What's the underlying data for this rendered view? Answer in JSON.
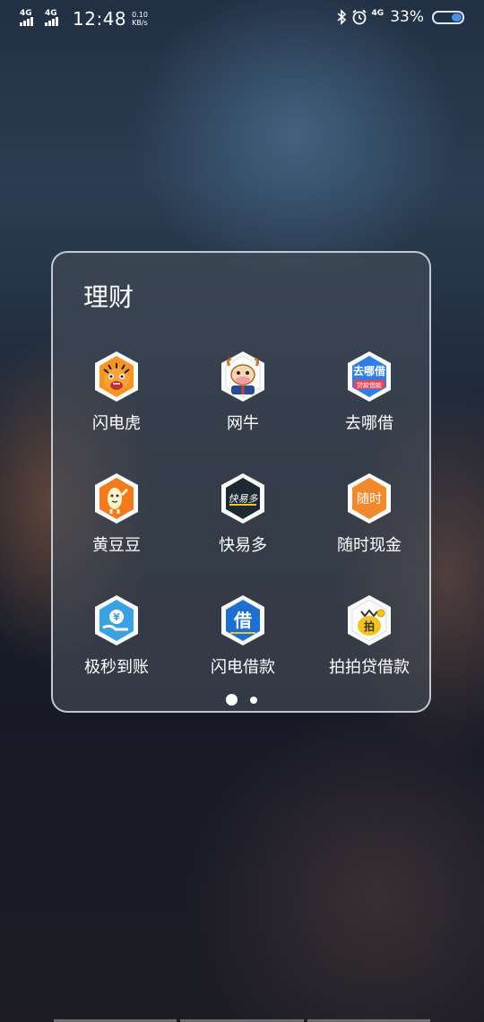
{
  "status_bar": {
    "signal1": "4G",
    "signal2": "4G",
    "time": "12:48",
    "speed_value": "0.10",
    "speed_unit": "KB/s",
    "network": "4G",
    "battery_percent": "33%",
    "battery_level": 0.33,
    "icons": [
      "bluetooth-icon",
      "alarm-icon"
    ]
  },
  "folder": {
    "title": "理财",
    "apps": [
      {
        "label": "闪电虎",
        "icon": "tiger-icon",
        "color": "#f28a1e"
      },
      {
        "label": "网牛",
        "icon": "cow-icon",
        "color": "#ffffff"
      },
      {
        "label": "去哪借",
        "icon_text": "去哪借",
        "icon_subtext": "贷款借款",
        "color": "#2f7ee6"
      },
      {
        "label": "黄豆豆",
        "icon": "bean-mascot-icon",
        "color": "#f27a1c"
      },
      {
        "label": "快易多",
        "icon_text": "快易多",
        "color": "#1e2a33"
      },
      {
        "label": "随时现金",
        "icon_text": "随时",
        "color": "#f08a2c"
      },
      {
        "label": "极秒到账",
        "icon_text": "¥",
        "color": "#3aa2e0"
      },
      {
        "label": "闪电借款",
        "icon_text": "借",
        "color": "#1f6fd1"
      },
      {
        "label": "拍拍贷借款",
        "icon_text": "拍",
        "color": "#fbfbfb"
      }
    ],
    "pages": 2,
    "current_page": 1
  }
}
